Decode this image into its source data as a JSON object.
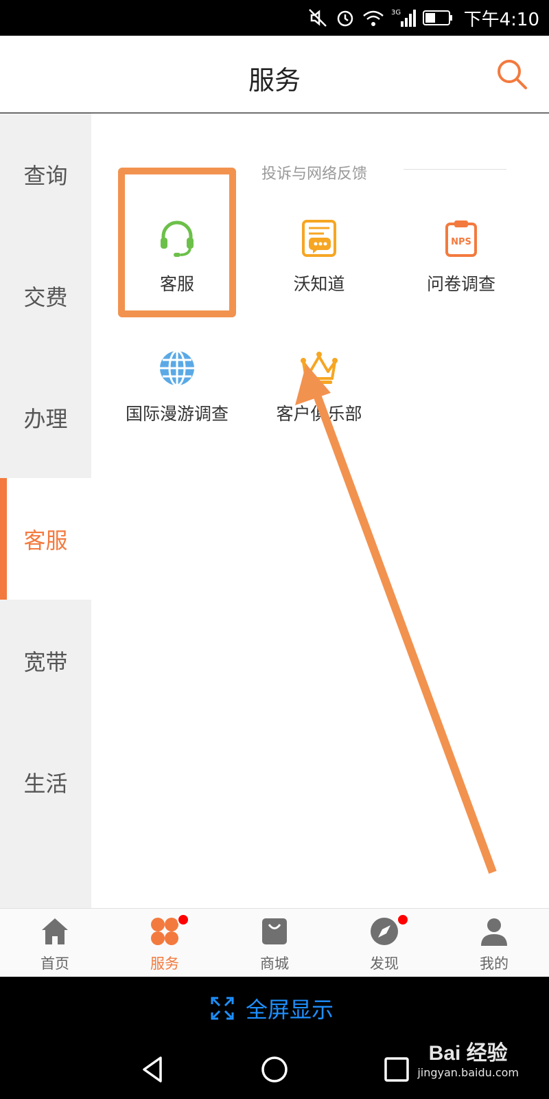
{
  "status_bar": {
    "time": "下午4:10",
    "network": "3G"
  },
  "header": {
    "title": "服务"
  },
  "sidebar": {
    "items": [
      {
        "label": "查询"
      },
      {
        "label": "交费"
      },
      {
        "label": "办理"
      },
      {
        "label": "客服"
      },
      {
        "label": "宽带"
      },
      {
        "label": "生活"
      }
    ]
  },
  "content": {
    "section_title": "投诉与网络反馈",
    "items": [
      {
        "label": "客服",
        "icon": "headset-icon"
      },
      {
        "label": "沃知道",
        "icon": "knowledge-doc-icon"
      },
      {
        "label": "问卷调查",
        "icon": "nps-clipboard-icon"
      },
      {
        "label": "国际漫游调查",
        "icon": "globe-icon"
      },
      {
        "label": "客户俱乐部",
        "icon": "crown-icon"
      }
    ]
  },
  "tabs": [
    {
      "label": "首页",
      "icon": "home-icon"
    },
    {
      "label": "服务",
      "icon": "service-icon"
    },
    {
      "label": "商城",
      "icon": "shopping-bag-icon"
    },
    {
      "label": "发现",
      "icon": "compass-icon"
    },
    {
      "label": "我的",
      "icon": "user-icon"
    }
  ],
  "fullscreen": {
    "label": "全屏显示"
  },
  "watermark": {
    "logo": "Bai 经验",
    "url": "jingyan.baidu.com"
  },
  "colors": {
    "accent": "#f37a3e",
    "highlight": "#f2924f",
    "link_blue": "#1e90ff",
    "sidebar_bg": "#f0f0f0"
  }
}
